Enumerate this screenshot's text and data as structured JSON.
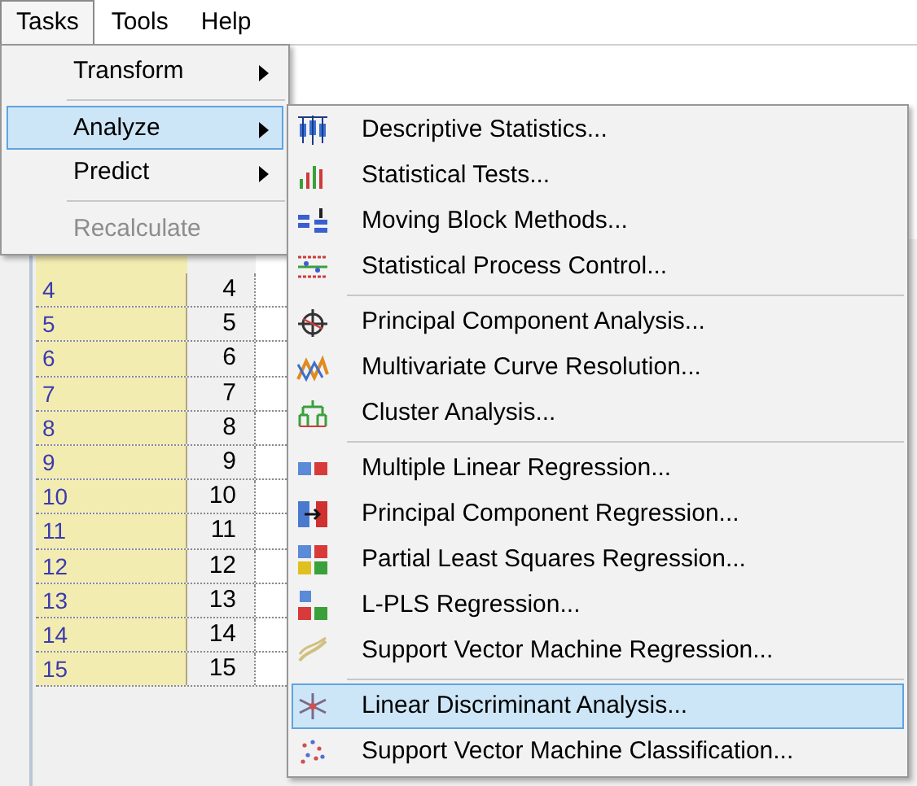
{
  "menu_bar": [
    {
      "label": "Tasks",
      "selected": true
    },
    {
      "label": "Tools",
      "selected": false
    },
    {
      "label": "Help",
      "selected": false
    }
  ],
  "tasks_menu": {
    "sections": [
      {
        "items": [
          {
            "label": "Transform",
            "has_submenu": true,
            "selected": false,
            "disabled": false
          }
        ]
      },
      {
        "items": [
          {
            "label": "Analyze",
            "has_submenu": true,
            "selected": true,
            "disabled": false
          },
          {
            "label": "Predict",
            "has_submenu": true,
            "selected": false,
            "disabled": false
          }
        ]
      },
      {
        "items": [
          {
            "label": "Recalculate",
            "has_submenu": false,
            "selected": false,
            "disabled": true
          }
        ]
      }
    ]
  },
  "analyze_menu": {
    "sections": [
      {
        "items": [
          {
            "label": "Descriptive Statistics...",
            "selected": false
          },
          {
            "label": "Statistical Tests...",
            "selected": false
          },
          {
            "label": "Moving Block Methods...",
            "selected": false
          },
          {
            "label": "Statistical Process Control...",
            "selected": false
          }
        ]
      },
      {
        "items": [
          {
            "label": "Principal Component Analysis...",
            "selected": false
          },
          {
            "label": "Multivariate Curve Resolution...",
            "selected": false
          },
          {
            "label": "Cluster Analysis...",
            "selected": false
          }
        ]
      },
      {
        "items": [
          {
            "label": "Multiple Linear Regression...",
            "selected": false
          },
          {
            "label": "Principal Component Regression...",
            "selected": false
          },
          {
            "label": "Partial Least Squares Regression...",
            "selected": false
          },
          {
            "label": "L-PLS Regression...",
            "selected": false
          },
          {
            "label": "Support Vector Machine Regression...",
            "selected": false
          }
        ]
      },
      {
        "items": [
          {
            "label": "Linear Discriminant Analysis...",
            "selected": true
          },
          {
            "label": "Support Vector Machine Classification...",
            "selected": false
          }
        ]
      }
    ]
  },
  "grid": {
    "rows": [
      {
        "row_header": "4",
        "value": "4"
      },
      {
        "row_header": "5",
        "value": "5"
      },
      {
        "row_header": "6",
        "value": "6"
      },
      {
        "row_header": "7",
        "value": "7"
      },
      {
        "row_header": "8",
        "value": "8"
      },
      {
        "row_header": "9",
        "value": "9"
      },
      {
        "row_header": "10",
        "value": "10"
      },
      {
        "row_header": "11",
        "value": "11"
      },
      {
        "row_header": "12",
        "value": "12"
      },
      {
        "row_header": "13",
        "value": "13"
      },
      {
        "row_header": "14",
        "value": "14"
      },
      {
        "row_header": "15",
        "value": "15"
      }
    ]
  }
}
